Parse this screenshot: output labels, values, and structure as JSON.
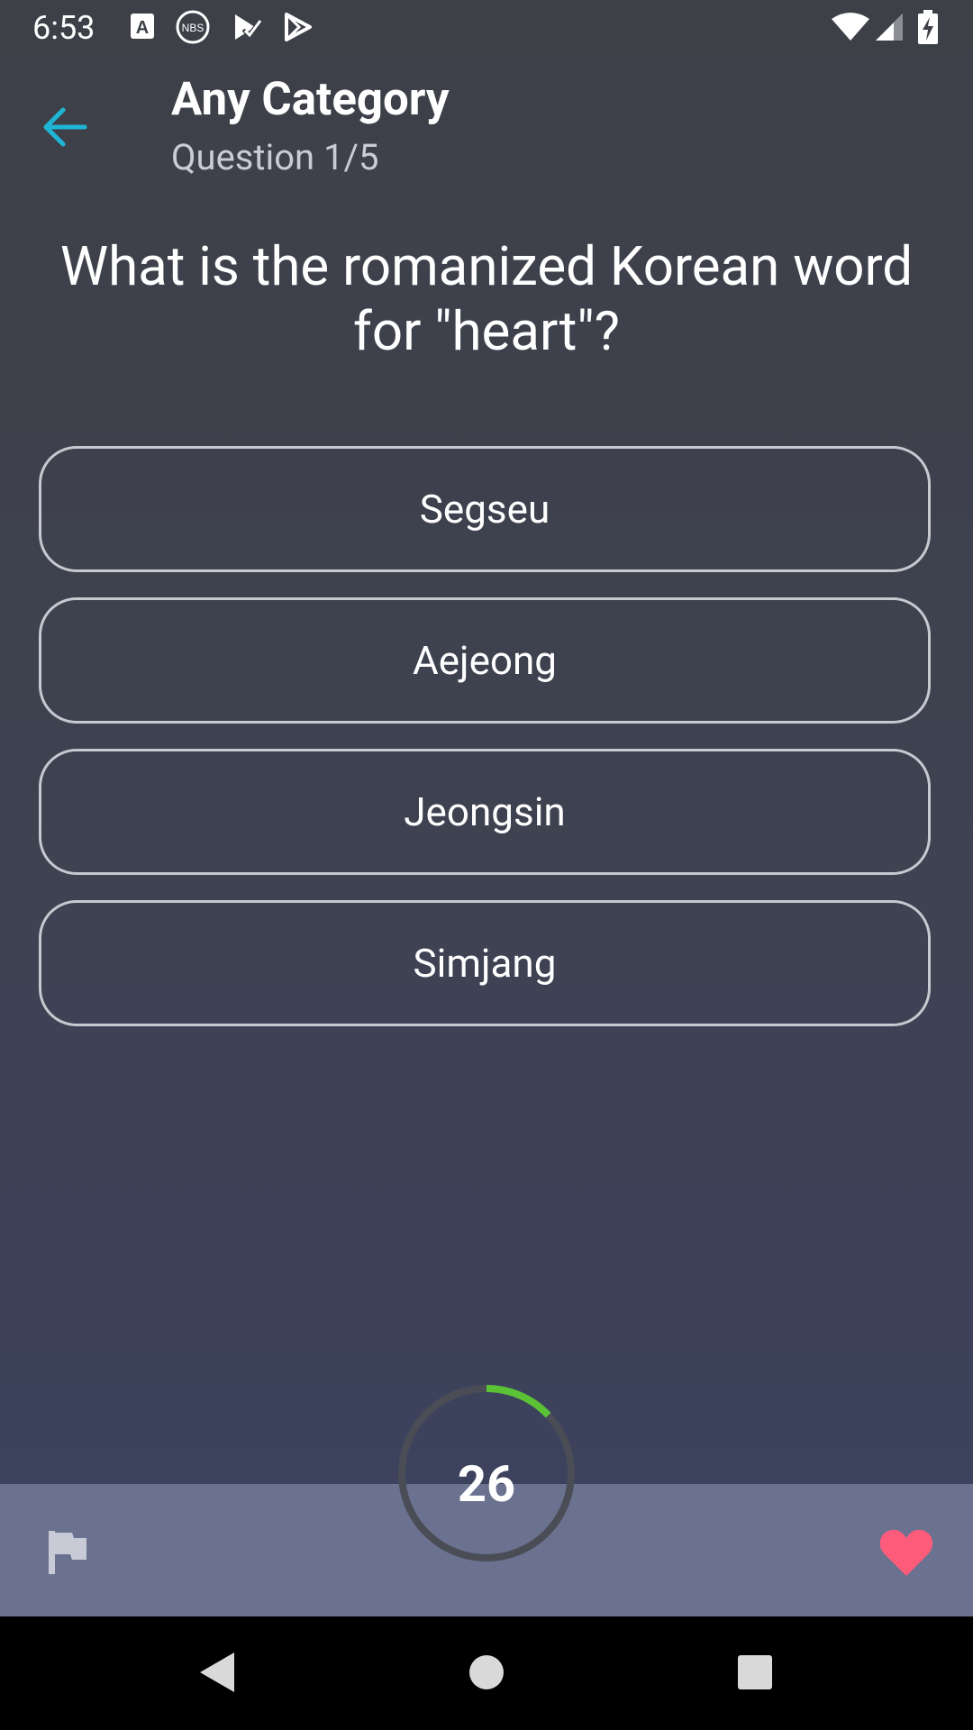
{
  "status_bar": {
    "time": "6:53",
    "icons": [
      "text-a-icon",
      "nbs-icon",
      "play-check-icon",
      "play-store-icon",
      "wifi-icon",
      "signal-icon",
      "battery-charging-icon"
    ]
  },
  "header": {
    "title": "Any Category",
    "subtitle": "Question 1/5",
    "back_icon": "arrow-left-icon",
    "accent_color": "#1fb6d6"
  },
  "question": {
    "text": "What is the romanized Korean word for \"heart\"?"
  },
  "answers": [
    {
      "label": "Segseu"
    },
    {
      "label": "Aejeong"
    },
    {
      "label": "Jeongsin"
    },
    {
      "label": "Simjang"
    }
  ],
  "timer": {
    "value": "26",
    "progress_fraction": 0.13,
    "progress_color": "#5bc236",
    "track_color": "#4a4d55"
  },
  "bottom_bar": {
    "left_icon": "flag-icon",
    "right_icon": "heart-icon",
    "heart_color": "#ff5c7c",
    "flag_color": "#c8cbd6"
  },
  "nav_bar": {
    "icons": [
      "back-triangle-icon",
      "home-circle-icon",
      "recents-square-icon"
    ]
  }
}
